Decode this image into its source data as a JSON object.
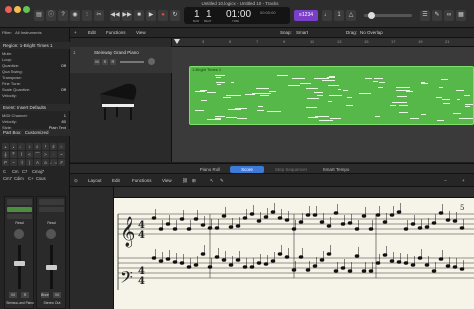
{
  "window": {
    "title": "Untitled 10.logicx - Untitled 10 - Tracks"
  },
  "control_bar": {
    "position_bar": "1",
    "position_beat": "1",
    "time": "01:00",
    "time_sub": "00:00:00",
    "bar_label": "BAR",
    "beat_label": "BEAT",
    "time_label": "TIME",
    "mode_badge": "≡1234"
  },
  "tracks_toolbar": {
    "edit": "Edit",
    "functions": "Functions",
    "view": "View",
    "snap_label": "Snap:",
    "snap_value": "Smart",
    "drag_label": "Drag:",
    "drag_value": "No Overlap"
  },
  "inspector": {
    "filter_label": "Filter:",
    "filter_value": "All Instruments",
    "region_header": "Region: 1-Bright Times 1",
    "rows": [
      {
        "label": "Mute:",
        "value": ""
      },
      {
        "label": "Loop:",
        "value": ""
      },
      {
        "label": "Quantize:",
        "value": "Off"
      },
      {
        "label": "Qua Swing:",
        "value": ""
      },
      {
        "label": "Transpose:",
        "value": ""
      },
      {
        "label": "Fine Tune:",
        "value": ""
      },
      {
        "label": "Scale Quantize:",
        "value": "Off"
      },
      {
        "label": "Velocity:",
        "value": ""
      }
    ],
    "event_header": "Event: Insert Defaults",
    "event_rows": [
      {
        "label": "MIDI Channel:",
        "value": "1"
      },
      {
        "label": "Velocity:",
        "value": "80"
      },
      {
        "label": "Style:",
        "value": "Plain Text"
      }
    ],
    "part_box_label": "Part Box:",
    "part_box_value": "Customized",
    "chords": [
      "C",
      "Cm",
      "C7",
      "Cmaj7",
      "Cm7",
      "Cdim",
      "C+",
      "Csus"
    ],
    "strip_left_label": "Steinwa..and Piano",
    "strip_right_label": "Stereo Out",
    "stereo_out": "Stereo Out",
    "read_label": "Read",
    "bnce_label": "Bnce",
    "m_label": "M",
    "s_label": "S"
  },
  "track": {
    "name": "Steinway Grand Piano",
    "number": "1",
    "m": "M",
    "s": "S",
    "r": "R"
  },
  "ruler": {
    "bars": [
      "1",
      "3",
      "5",
      "7",
      "9",
      "11",
      "13",
      "15",
      "17",
      "19",
      "21"
    ]
  },
  "region": {
    "name": "1-Bright Times 1"
  },
  "editor_tabs": [
    "Piano Roll",
    "Score",
    "Step Sequencer",
    "Smart Tempo"
  ],
  "editor_active_tab": "Score",
  "editor_toolbar": {
    "layout": "Layout",
    "edit": "Edit",
    "functions": "Functions",
    "view": "View"
  },
  "score": {
    "bar_number": "5",
    "time_sig_top": "4",
    "time_sig_bottom": "4"
  },
  "colors": {
    "region": "#57b84a",
    "accent": "#3c7bd9",
    "score_paper": "#f6f3e8"
  }
}
